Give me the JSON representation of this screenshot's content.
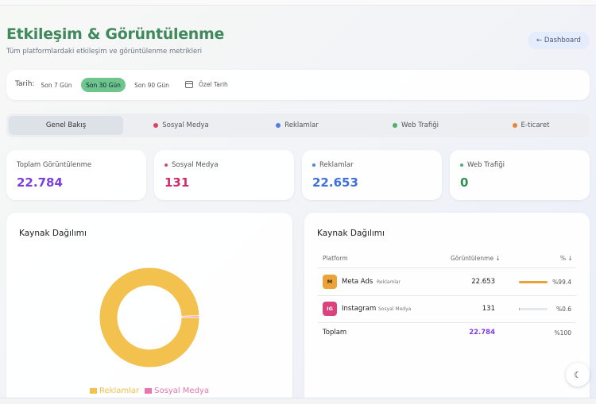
{
  "header": {
    "title": "Etkileşim & Görüntülenme",
    "subtitle": "Tüm platformlardaki etkileşim ve görüntülenme metrikleri",
    "dashboard_label": "← Dashboard"
  },
  "date_filter": {
    "label": "Tarih:",
    "options": [
      "Son 7 Gün",
      "Son 30 Gün",
      "Son 90 Gün"
    ],
    "active": "Son 30 Gün",
    "custom_label": "Özel Tarih"
  },
  "tabs": [
    {
      "label": "Genel Bakış",
      "active": true,
      "color": ""
    },
    {
      "label": "Sosyal Medya",
      "color": "#d9445e"
    },
    {
      "label": "Reklamlar",
      "color": "#4f7ee8"
    },
    {
      "label": "Web Trafiği",
      "color": "#4caf6a"
    },
    {
      "label": "E-ticaret",
      "color": "#e8843a"
    }
  ],
  "stats": [
    {
      "label": "Toplam Görüntülenme",
      "value": "22.784",
      "color": "#7b3fe0"
    },
    {
      "label": "Sosyal Medya",
      "value": "131",
      "color": "#d12a6a",
      "dot": "#d9447e"
    },
    {
      "label": "Reklamlar",
      "value": "22.653",
      "color": "#3f6fd8",
      "dot": "#4f7ee8"
    },
    {
      "label": "Web Trafiği",
      "value": "0",
      "color": "#2f8f52",
      "dot": "#4caf6a"
    }
  ],
  "left_panel": {
    "title": "Kaynak Dağılımı",
    "legend": [
      {
        "label": "Reklamlar",
        "color": "#f2c14e"
      },
      {
        "label": "Sosyal Medya",
        "color": "#e676ad"
      }
    ]
  },
  "chart_data": {
    "type": "pie",
    "title": "Kaynak Dağılımı",
    "categories": [
      "Reklamlar",
      "Sosyal Medya"
    ],
    "values": [
      22653,
      131
    ],
    "colors": [
      "#f2c14e",
      "#e676ad"
    ],
    "legend_position": "bottom"
  },
  "right_panel": {
    "title": "Kaynak Dağılımı",
    "columns": {
      "platform": "Platform",
      "views": "Görüntülenme ↓",
      "pct": "% ↓"
    },
    "rows": [
      {
        "badge": "M",
        "badge_color": "#eaa33b",
        "name": "Meta Ads",
        "category": "Reklamlar",
        "views": "22.653",
        "pct": "%99.4",
        "share": 0.994,
        "bar_color": "#eaa33b"
      },
      {
        "badge": "IG",
        "badge_color": "#d9447e",
        "name": "Instagram",
        "category": "Sosyal Medya",
        "views": "131",
        "pct": "%0.6",
        "share": 0.006,
        "bar_color": "#9ca3af"
      }
    ],
    "total": {
      "label": "Toplam",
      "views": "22.784",
      "pct": "%100"
    }
  },
  "fab": {
    "icon": "moon-icon"
  }
}
